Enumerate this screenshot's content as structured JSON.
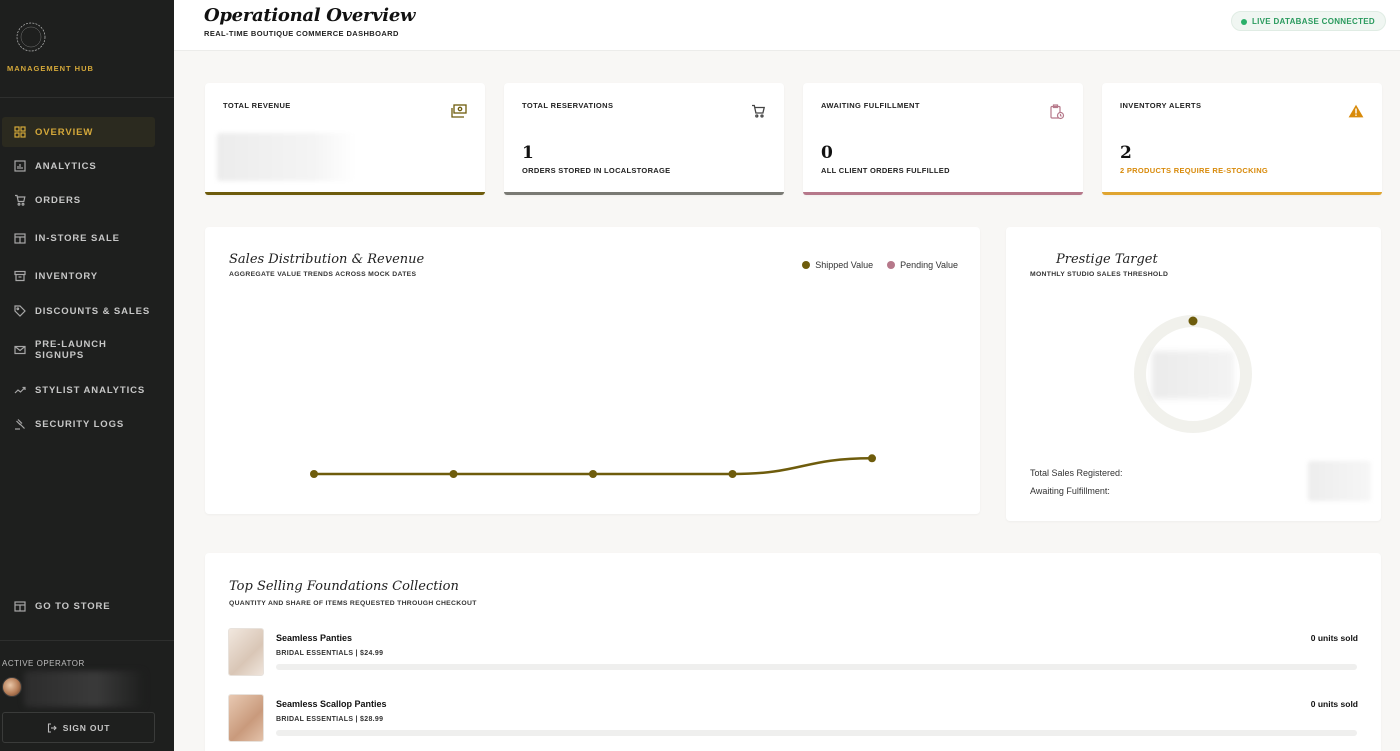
{
  "sidebar": {
    "brand_label": "MANAGEMENT HUB",
    "items": [
      {
        "label": "OVERVIEW",
        "icon": "grid-icon",
        "active": true
      },
      {
        "label": "ANALYTICS",
        "icon": "bar-chart-icon"
      },
      {
        "label": "ORDERS",
        "icon": "cart-icon"
      },
      {
        "label": "IN-STORE SALE",
        "icon": "storefront-icon"
      },
      {
        "label": "INVENTORY",
        "icon": "archive-box-icon"
      },
      {
        "label": "DISCOUNTS & SALES",
        "icon": "tag-icon"
      },
      {
        "label": "PRE-LAUNCH\nSIGNUPS",
        "icon": "envelope-icon"
      },
      {
        "label": "STYLIST ANALYTICS",
        "icon": "trend-line-icon"
      },
      {
        "label": "SECURITY LOGS",
        "icon": "gavel-icon"
      }
    ],
    "go_to_store": "GO TO STORE",
    "active_operator_label": "ACTIVE OPERATOR",
    "sign_out": "SIGN OUT"
  },
  "header": {
    "title": "Operational Overview",
    "subtitle": "REAL-TIME BOUTIQUE COMMERCE DASHBOARD",
    "db_status": "LIVE DATABASE CONNECTED",
    "db_status_color": "#2bb06a"
  },
  "stats": [
    {
      "title": "TOTAL REVENUE",
      "icon": "cash-icon",
      "value": "",
      "note": "",
      "bar_color": "#6e5c0c"
    },
    {
      "title": "TOTAL RESERVATIONS",
      "icon": "cart-icon",
      "value": "1",
      "note": "ORDERS STORED IN LOCALSTORAGE",
      "bar_color": "#7a7a74"
    },
    {
      "title": "AWAITING FULFILLMENT",
      "icon": "clipboard-clock-icon",
      "value": "0",
      "note": "ALL CLIENT ORDERS FULFILLED",
      "bar_color": "#b6788a"
    },
    {
      "title": "INVENTORY ALERTS",
      "icon": "warning-triangle-icon",
      "value": "2",
      "note": "2 PRODUCTS REQUIRE RE-STOCKING",
      "bar_color": "#e0a530",
      "note_color": "#d88a0a"
    }
  ],
  "sales_chart": {
    "title": "Sales Distribution & Revenue",
    "subtitle": "AGGREGATE VALUE TRENDS ACROSS MOCK DATES",
    "legend": [
      {
        "name": "Shipped Value",
        "color": "#6e5c0c"
      },
      {
        "name": "Pending Value",
        "color": "#b6788a"
      }
    ]
  },
  "chart_data": {
    "type": "line",
    "title": "Sales Distribution & Revenue",
    "series": [
      {
        "name": "Shipped Value",
        "color": "#6e5c0c",
        "values": [
          0,
          0,
          0,
          0,
          1
        ]
      }
    ],
    "x": [
      1,
      2,
      3,
      4,
      5
    ],
    "ylim": [
      0,
      10
    ],
    "grid": false,
    "legend_position": "top-right"
  },
  "target": {
    "title": "Prestige Target",
    "subtitle": "MONTHLY STUDIO SALES THRESHOLD",
    "progress": 0.0,
    "ring_color": "#f1f1ec",
    "marker_color": "#6e5c0c",
    "total_sales_label": "Total Sales Registered:",
    "awaiting_label": "Awaiting Fulfillment:"
  },
  "products": {
    "title": "Top Selling Foundations Collection",
    "subtitle": "QUANTITY AND SHARE OF ITEMS REQUESTED THROUGH CHECKOUT",
    "items": [
      {
        "name": "Seamless Panties",
        "meta": "BRIDAL ESSENTIALS | $24.99",
        "units": "0 units sold",
        "share": 0.0
      },
      {
        "name": "Seamless Scallop Panties",
        "meta": "BRIDAL ESSENTIALS | $28.99",
        "units": "0 units sold",
        "share": 0.0
      }
    ]
  }
}
